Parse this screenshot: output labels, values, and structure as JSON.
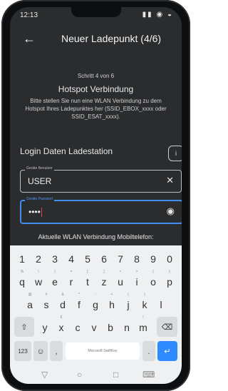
{
  "status": {
    "time": "12:13",
    "icons": "▮▮ ◉ ◒"
  },
  "appbar": {
    "back": "←",
    "title": "Neuer Ladepunkt (4/6)"
  },
  "content": {
    "step": "Schritt 4 von 6",
    "heading": "Hotspot Verbindung",
    "description": "Bitte stellen Sie nun eine WLAN Verbindung zu dem Hotspot Ihres Ladepunktes her (SSID_EBOX_xxxx oder SSID_ESAT_xxxx).",
    "login_title": "Login Daten Ladestation",
    "info_label": "i",
    "user_field": {
      "label": "Geräte Benutzer",
      "value": "USER",
      "clear_icon": "✕"
    },
    "pass_field": {
      "label": "Geräte Passwort",
      "value": "••••",
      "eye_icon": "◉"
    },
    "wifi_text": "Aktuelle WLAN Verbindung Mobiltelefon:"
  },
  "keyboard": {
    "numbers": [
      "1",
      "2",
      "3",
      "4",
      "5",
      "6",
      "7",
      "8",
      "9",
      "0"
    ],
    "row1": [
      "q",
      "w",
      "e",
      "r",
      "t",
      "z",
      "u",
      "i",
      "o",
      "p"
    ],
    "row1_sup": [
      "%",
      "\\",
      "|",
      "=",
      "[",
      "]",
      "<",
      ">",
      "{",
      "}"
    ],
    "row2": [
      "a",
      "s",
      "d",
      "f",
      "g",
      "h",
      "j",
      "k",
      "l"
    ],
    "row2_sup": [
      "@",
      "#",
      "&",
      "*",
      "-",
      "+",
      "(",
      ")",
      ""
    ],
    "row3": [
      "y",
      "x",
      "c",
      "v",
      "b",
      "n",
      "m"
    ],
    "row3_sup": [
      "",
      "€",
      "",
      "",
      "",
      "",
      "!"
    ],
    "shift": "⇧",
    "backspace": "⌫",
    "symbols": "123",
    "emoji": "☺",
    "comma": ",",
    "space_label": "Microsoft SwiftKey",
    "period": ".",
    "enter": "↵"
  },
  "navbar": {
    "back": "▽",
    "home": "○",
    "recents": "□",
    "keyboard": "⌨"
  }
}
